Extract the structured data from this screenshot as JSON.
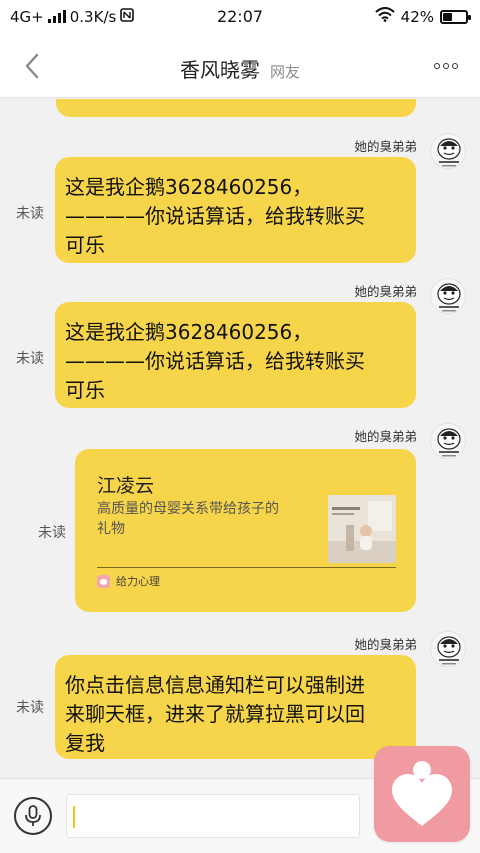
{
  "status_bar": {
    "network": "4G+",
    "speed": "0.3K/s",
    "time": "22:07",
    "battery": "42%",
    "battery_level": 0.42,
    "icons": [
      "signal-bars-icon",
      "nfc-off-icon",
      "wifi-icon",
      "battery-icon"
    ]
  },
  "header": {
    "title": "香风晓雾",
    "relation": "网友",
    "icons": [
      "back-chevron-icon",
      "more-dots-icon"
    ]
  },
  "messages": [
    {
      "type": "text",
      "sender": "她的臭弟弟",
      "status": "未读",
      "lines": [
        "这是我企鹅3628460256，",
        "————你说话算话，给我转账买",
        "可乐"
      ]
    },
    {
      "type": "text",
      "sender": "她的臭弟弟",
      "status": "未读",
      "lines": [
        "这是我企鹅3628460256，",
        "————你说话算话，给我转账买",
        "可乐"
      ]
    },
    {
      "type": "card",
      "sender": "她的臭弟弟",
      "status": "未读",
      "card": {
        "title": "江凌云",
        "desc_lines": [
          "高质量的母婴关系带给孩子的",
          "礼物"
        ],
        "source": "给力心理"
      }
    },
    {
      "type": "text",
      "sender": "她的臭弟弟",
      "status": "未读",
      "lines": [
        "你点击信息信息通知栏可以强制进",
        "来聊天框，进来了就算拉黑可以回",
        "复我"
      ]
    }
  ],
  "input": {
    "value": "",
    "icons": [
      "microphone-icon"
    ]
  },
  "floating_widget": {
    "icon": "heart-person-icon",
    "color": "#f09aa1"
  },
  "colors": {
    "bubble": "#f7d54a",
    "background": "#f1f1f1"
  }
}
